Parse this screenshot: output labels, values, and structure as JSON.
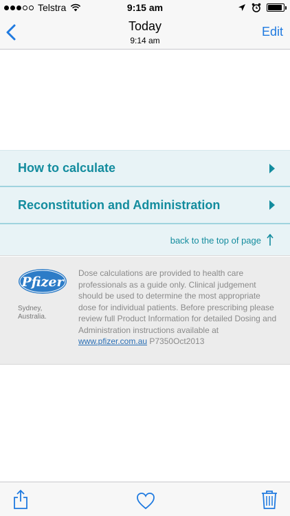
{
  "status_bar": {
    "carrier": "Telstra",
    "time": "9:15 am",
    "signal_bars_filled": 3,
    "signal_bars_total": 5,
    "battery_level": 0.9
  },
  "nav": {
    "back_icon": "chevron-left-icon",
    "title": "Today",
    "subtitle": "9:14 am",
    "edit_label": "Edit"
  },
  "sections": [
    {
      "label": "How to calculate",
      "icon": "disclosure-arrow-icon"
    },
    {
      "label": "Reconstitution and Administration",
      "icon": "disclosure-arrow-icon"
    }
  ],
  "back_to_top": {
    "label": "back to the top of page",
    "icon": "arrow-up-icon"
  },
  "footer": {
    "logo_text": "Pfizer",
    "location_line1": "Sydney,",
    "location_line2": "Australia.",
    "disclaimer": "Dose calculations are provided to health care professionals as a guide only. Clinical judgement should be used to determine the most appropriate dose for individual patients. Before prescribing please review full Product Information for detailed Dosing and Administration instructions available at",
    "link_text": "www.pfizer.com.au",
    "code": " P7350Oct2013"
  },
  "toolbar": {
    "share_icon": "share-icon",
    "heart_icon": "heart-icon",
    "trash_icon": "trash-icon"
  },
  "colors": {
    "accent_blue": "#1f7ae0",
    "teal": "#138c9e",
    "section_bg": "#e8f3f6",
    "pfizer_blue": "#2d7cc7"
  }
}
